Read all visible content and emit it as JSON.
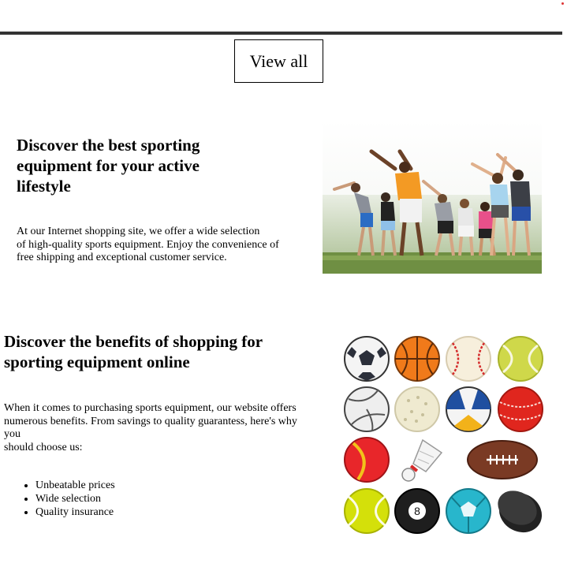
{
  "header": {
    "view_all_label": "View all"
  },
  "section1": {
    "title": "Discover the best sporting equipment for your active lifestyle",
    "body_lines": [
      "At our Internet shopping site, we offer a wide selection",
      "of high-quality sports equipment. Enjoy the convenience of",
      "free shipping and exceptional customer service."
    ]
  },
  "section2": {
    "title": "Discover the benefits of shopping for sporting equipment online",
    "body_lines": [
      "When it comes to purchasing sports equipment, our website offers",
      "numerous benefits. From savings to quality guarantess, here's why",
      "you",
      "should choose us:"
    ],
    "benefits": [
      "Unbeatable prices",
      "Wide selection",
      "Quality insurance"
    ]
  },
  "colors": {
    "divider": "#333333",
    "border": "#000000",
    "text": "#000000",
    "background": "#ffffff"
  },
  "images": {
    "photo": "group-stretching-outdoors-photo",
    "balls": "sports-balls-illustration",
    "eight_ball_number": "8"
  }
}
